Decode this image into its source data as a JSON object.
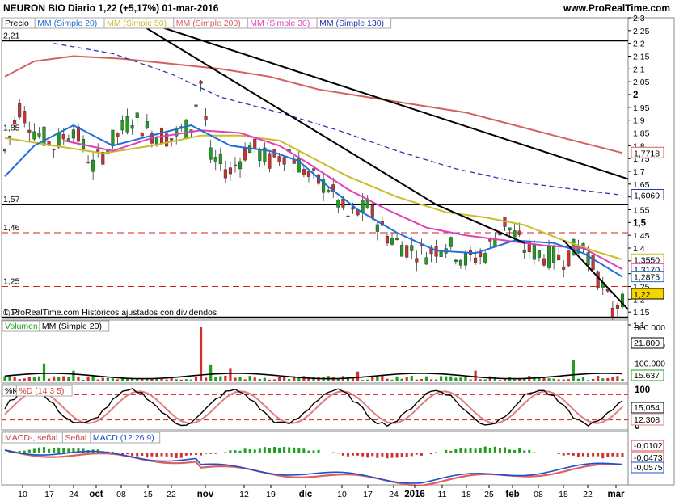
{
  "header": {
    "title": "NEURON BIO   Diario    1,22 (+5,17%)   01-mar-2016",
    "site": "www.ProRealTime.com"
  },
  "price_panel": {
    "legend": [
      "Precio",
      "MM (Simple 20)",
      "MM (Simple 50)",
      "MM (Simple 200)",
      "MM (Simple 30)",
      "MM (Simple 130)"
    ],
    "hlines": [
      "2,21",
      "1,85",
      "1,57",
      "1,46",
      "1,25",
      "1,13"
    ],
    "yticks": [
      "2,3",
      "2,25",
      "2,2",
      "2,15",
      "2,1",
      "2,05",
      "2",
      "1,95",
      "1,9",
      "1,85",
      "1,8",
      "1,75",
      "1,7",
      "1,65",
      "1,6",
      "1,55",
      "1,5",
      "1,45",
      "1,4",
      "1,35",
      "1,3",
      "1,25",
      "1,2",
      "1,15",
      "1,1"
    ],
    "value_labels": [
      "1,7718",
      "1,6069",
      "1,3550",
      "1,3170",
      "1,2875",
      "1,22"
    ],
    "footer": "© ProRealTime.com  Históricos ajustados con dividendos"
  },
  "volume_panel": {
    "legend": [
      "Volumen",
      "MM (Simple 20)"
    ],
    "yticks": [
      "300.000",
      "200.000",
      "100.000"
    ],
    "value_labels": [
      "21.800",
      "15.637"
    ]
  },
  "stoch_panel": {
    "legend": [
      "%K",
      "%D (14 3 5)"
    ],
    "yticks": [
      "100",
      "0"
    ],
    "value_labels": [
      "15,054",
      "12,308"
    ]
  },
  "macd_panel": {
    "legend": [
      "MACD-, señal",
      "Señal",
      "MACD (12 26 9)"
    ],
    "value_labels": [
      "-0,0102",
      "-0,0473",
      "-0,0575"
    ]
  },
  "xaxis": [
    "10",
    "17",
    "24",
    "oct",
    "08",
    "15",
    "22",
    "nov",
    "12",
    "19",
    "dic",
    "10",
    "17",
    "24",
    "2016",
    "11",
    "18",
    "25",
    "feb",
    "08",
    "15",
    "22",
    "mar"
  ],
  "colors": {
    "ma20": "#1f6fd6",
    "ma50": "#c8be2a",
    "ma200": "#d46060",
    "ma30": "#e040b8",
    "ma130": "#2b35b0",
    "up": "#1f9e1f",
    "down": "#d03030"
  },
  "chart_data": {
    "type": "candlestick",
    "title": "NEURON BIO Diario",
    "last_close": 1.22,
    "change_pct": 5.17,
    "date": "01-mar-2016",
    "ylim": [
      1.1,
      2.3
    ],
    "support_resistance": [
      2.21,
      1.85,
      1.57,
      1.46,
      1.25,
      1.13
    ],
    "ma_last_values": {
      "MM (Simple 20)": 1.2875,
      "MM (Simple 50)": 1.355,
      "MM (Simple 200)": 1.7718,
      "MM (Simple 30)": 1.317,
      "MM (Simple 130)": 1.6069
    },
    "volume_ma20_last": 15637,
    "volume_last": 21800,
    "stochastic": {
      "k": 15.054,
      "d": 12.308
    },
    "macd": {
      "macd": -0.0575,
      "signal": -0.0473,
      "histogram": -0.0102
    }
  }
}
